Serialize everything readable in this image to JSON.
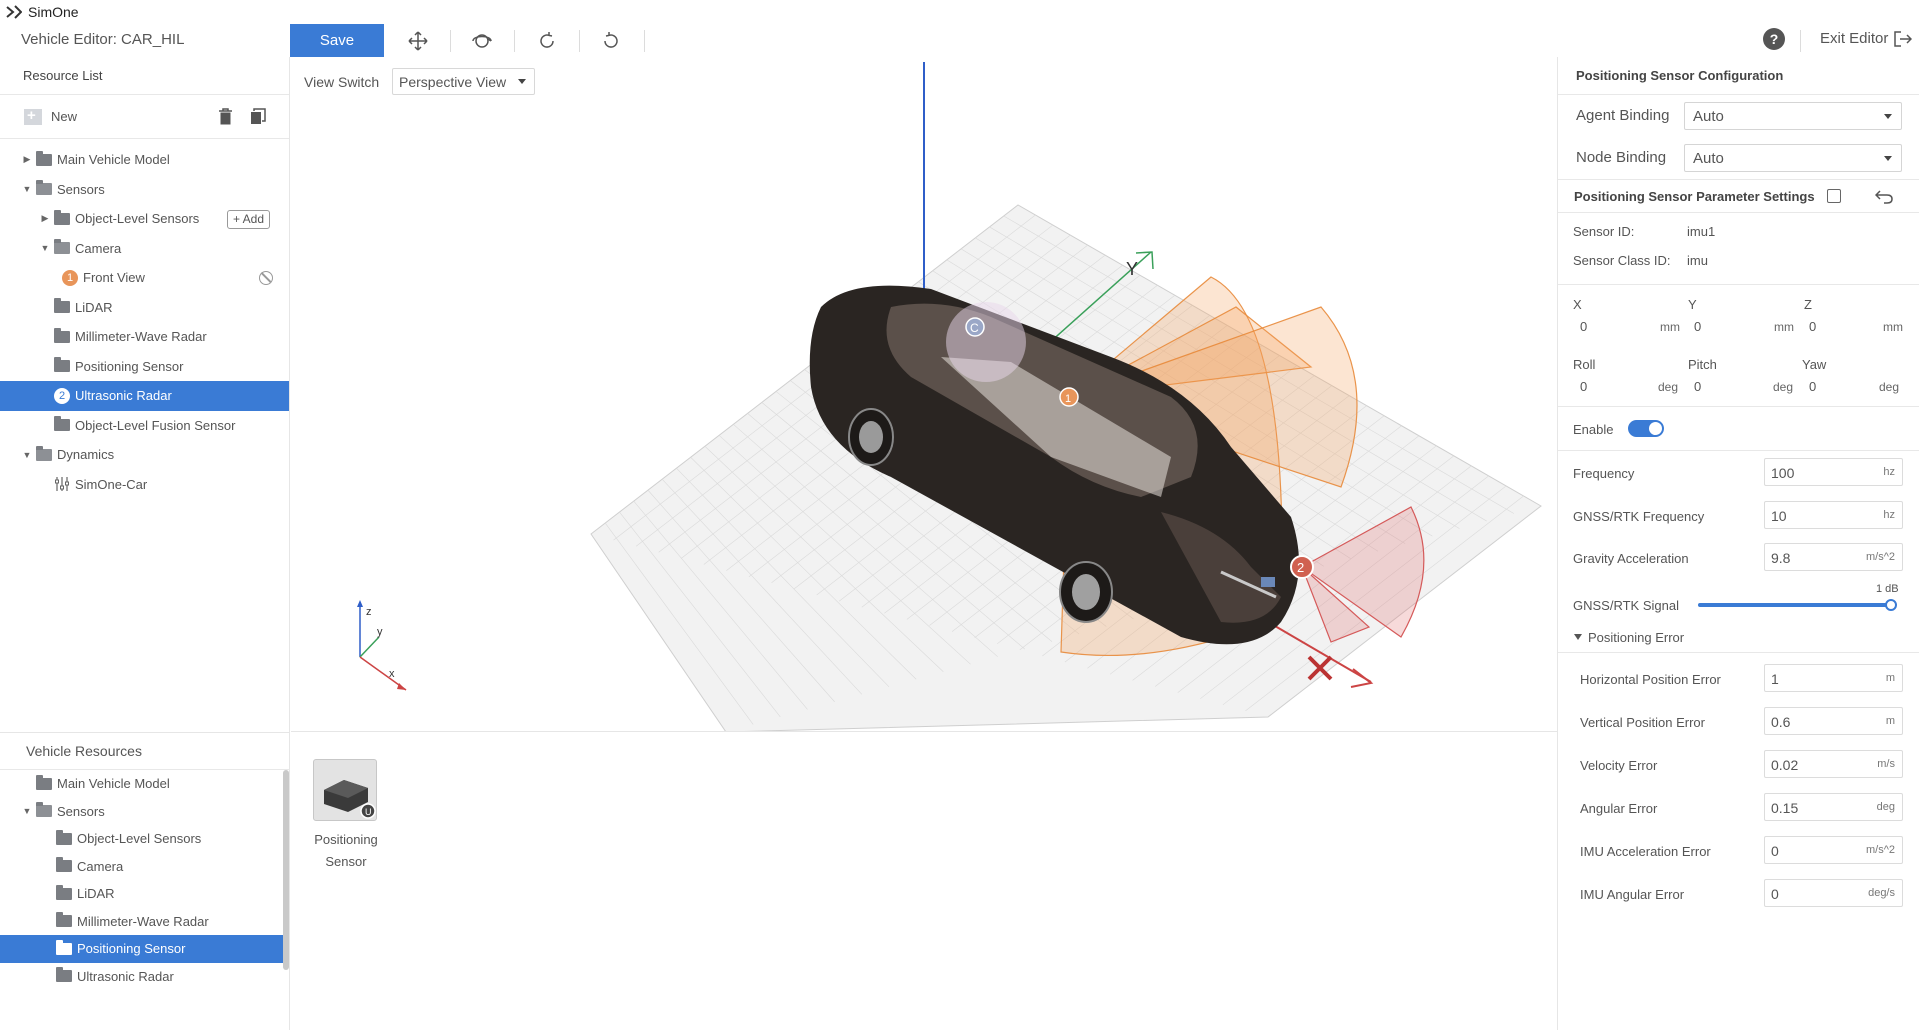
{
  "app": {
    "name": "SimOne"
  },
  "toolbar": {
    "vehicle_editor": "Vehicle Editor: CAR_HIL",
    "save_label": "Save",
    "exit_label": "Exit Editor",
    "help_label": "?"
  },
  "resource_list": {
    "title": "Resource List",
    "new_label": "New",
    "add_label": "+ Add",
    "tree": [
      {
        "label": "Main Vehicle Model",
        "caret": "right",
        "depth": 0,
        "kind": "folder"
      },
      {
        "label": "Sensors",
        "caret": "down",
        "depth": 0,
        "kind": "folder-open"
      },
      {
        "label": "Object-Level Sensors",
        "caret": "right",
        "depth": 1,
        "kind": "folder"
      },
      {
        "label": "Camera",
        "caret": "down",
        "depth": 1,
        "kind": "folder-open"
      },
      {
        "label": "Front View",
        "badge": "1",
        "depth": 2,
        "kind": "item"
      },
      {
        "label": "LiDAR",
        "depth": 1,
        "kind": "folder"
      },
      {
        "label": "Millimeter-Wave Radar",
        "depth": 1,
        "kind": "folder"
      },
      {
        "label": "Positioning Sensor",
        "depth": 1,
        "kind": "folder"
      },
      {
        "label": "Ultrasonic Radar",
        "badge": "2",
        "depth": 1,
        "kind": "item",
        "selected": true
      },
      {
        "label": "Object-Level Fusion Sensor",
        "depth": 1,
        "kind": "folder"
      },
      {
        "label": "Dynamics",
        "caret": "down",
        "depth": 0,
        "kind": "folder-open"
      },
      {
        "label": "SimOne-Car",
        "depth": 1,
        "kind": "dynamics"
      }
    ]
  },
  "vehicle_resources": {
    "title": "Vehicle Resources",
    "tree": [
      {
        "label": "Main Vehicle Model",
        "depth": 0
      },
      {
        "label": "Sensors",
        "depth": 0,
        "caret": "down"
      },
      {
        "label": "Object-Level Sensors",
        "depth": 1
      },
      {
        "label": "Camera",
        "depth": 1
      },
      {
        "label": "LiDAR",
        "depth": 1
      },
      {
        "label": "Millimeter-Wave Radar",
        "depth": 1
      },
      {
        "label": "Positioning Sensor",
        "depth": 1,
        "selected": true
      },
      {
        "label": "Ultrasonic Radar",
        "depth": 1
      }
    ],
    "tile": {
      "label": "Positioning Sensor"
    }
  },
  "viewport": {
    "view_switch_label": "View Switch",
    "view_mode": "Perspective View",
    "axis_labels": {
      "y": "Y",
      "z": "z",
      "small_y": "y",
      "small_x": "x"
    },
    "markers": [
      "C",
      "1",
      "2"
    ]
  },
  "config": {
    "title": "Positioning Sensor Configuration",
    "agent_binding_label": "Agent Binding",
    "agent_binding_value": "Auto",
    "node_binding_label": "Node Binding",
    "node_binding_value": "Auto",
    "params_title": "Positioning Sensor Parameter Settings",
    "sensor_id_label": "Sensor ID:",
    "sensor_id": "imu1",
    "sensor_class_label": "Sensor Class ID:",
    "sensor_class": "imu",
    "position": {
      "x_label": "X",
      "y_label": "Y",
      "z_label": "Z",
      "x": "0",
      "y": "0",
      "z": "0",
      "unit": "mm"
    },
    "rotation": {
      "roll_label": "Roll",
      "pitch_label": "Pitch",
      "yaw_label": "Yaw",
      "roll": "0",
      "pitch": "0",
      "yaw": "0",
      "unit": "deg"
    },
    "enable_label": "Enable",
    "enabled": true,
    "frequency": {
      "label": "Frequency",
      "value": "100",
      "unit": "hz"
    },
    "gnss_frequency": {
      "label": "GNSS/RTK Frequency",
      "value": "10",
      "unit": "hz"
    },
    "gravity": {
      "label": "Gravity Acceleration",
      "value": "9.8",
      "unit": "m/s^2"
    },
    "gnss_signal": {
      "label": "GNSS/RTK Signal",
      "tip": "1 dB",
      "level": 1.0
    },
    "error_title": "Positioning Error",
    "errors": [
      {
        "label": "Horizontal Position Error",
        "value": "1",
        "unit": "m"
      },
      {
        "label": "Vertical Position Error",
        "value": "0.6",
        "unit": "m"
      },
      {
        "label": "Velocity Error",
        "value": "0.02",
        "unit": "m/s"
      },
      {
        "label": "Angular Error",
        "value": "0.15",
        "unit": "deg"
      },
      {
        "label": "IMU Acceleration Error",
        "value": "0",
        "unit": "m/s^2"
      },
      {
        "label": "IMU Angular Error",
        "value": "0",
        "unit": "deg/s"
      }
    ]
  },
  "colors": {
    "accent": "#3a7bd5",
    "cone_orange": "#f3a35c",
    "cone_red": "#e06a6a"
  }
}
